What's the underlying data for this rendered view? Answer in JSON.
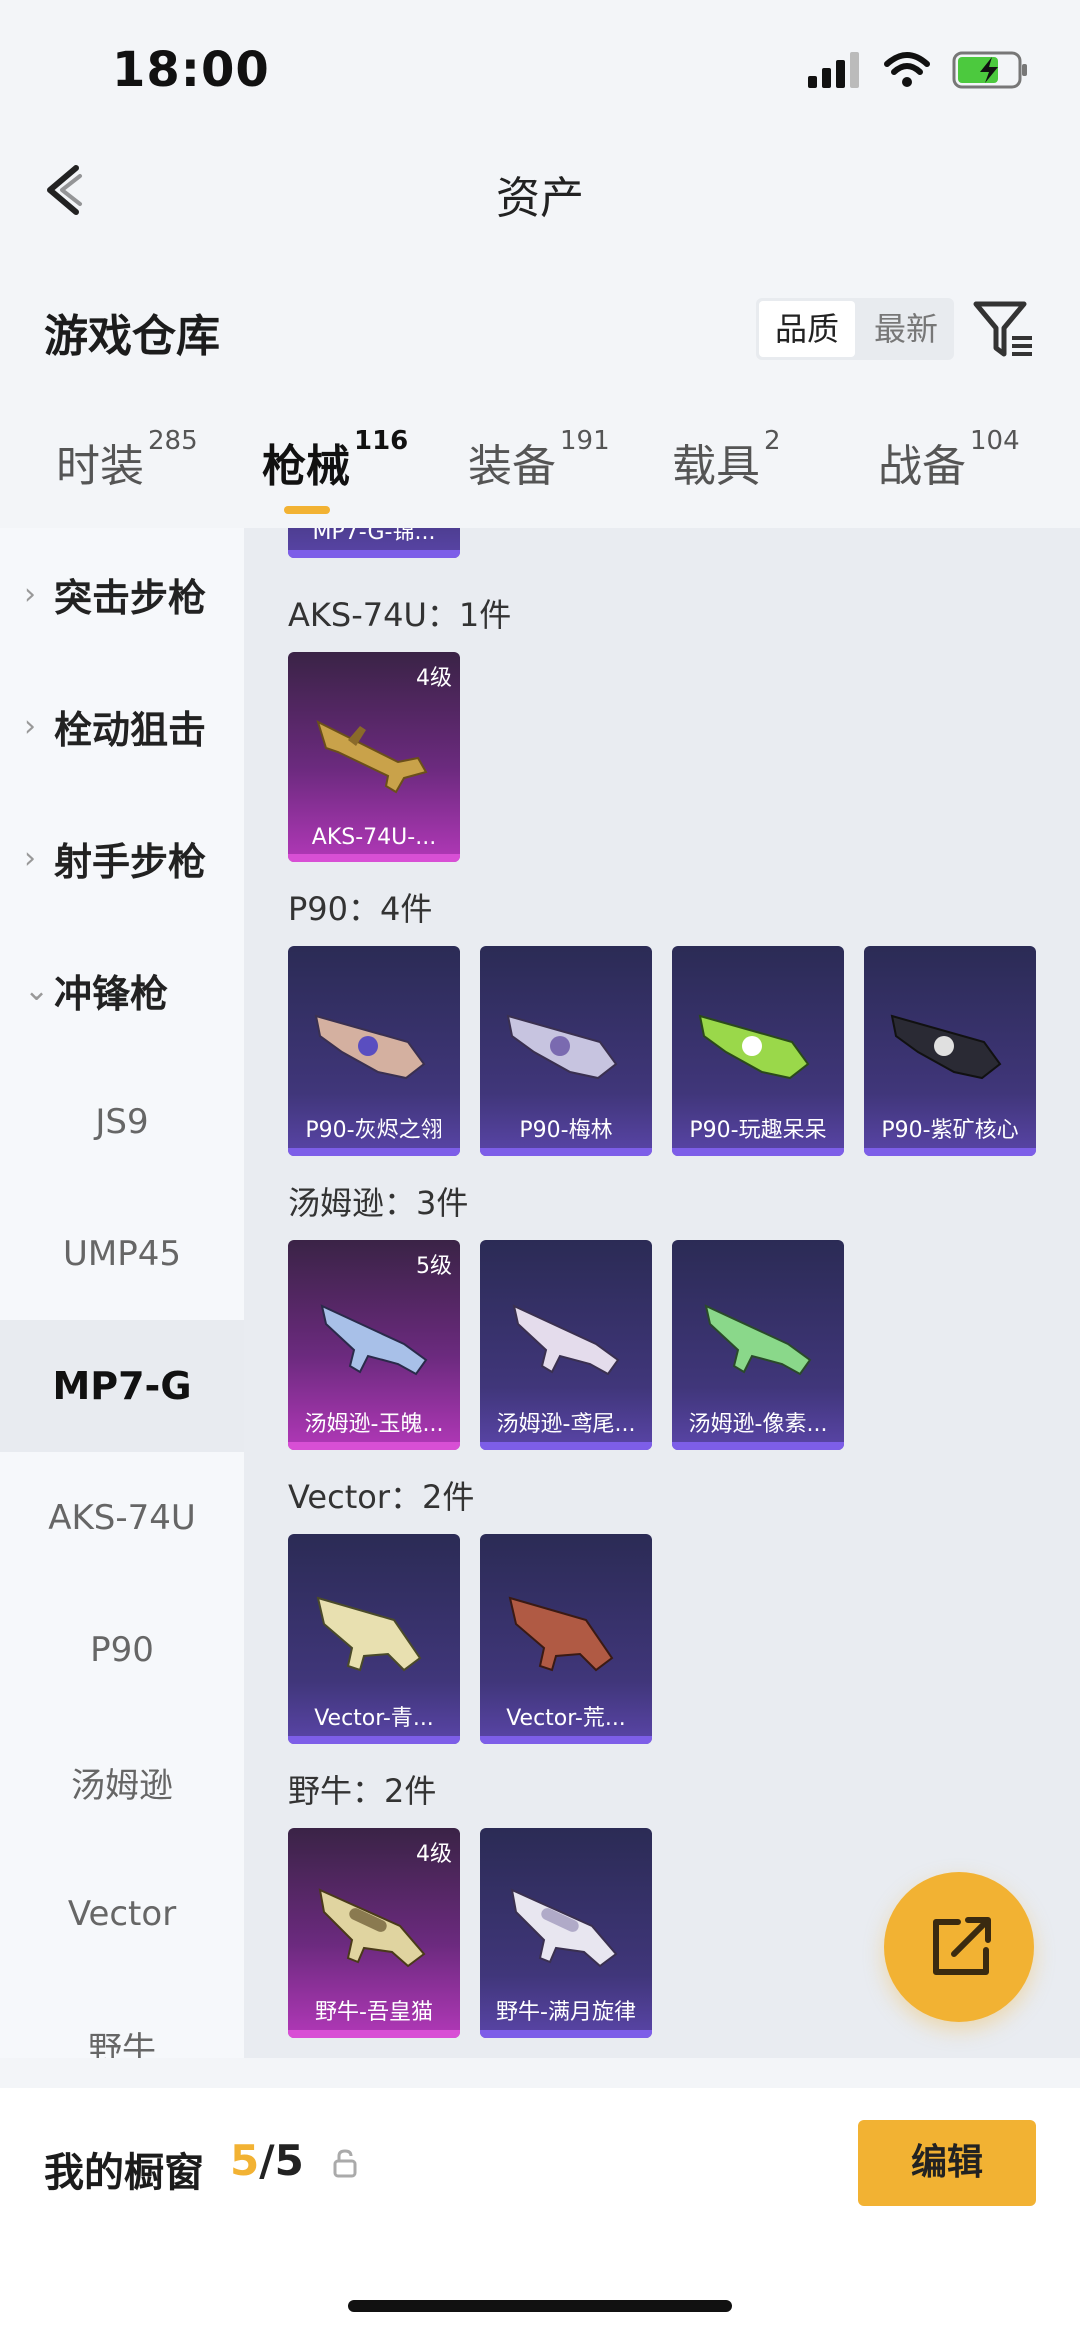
{
  "status": {
    "time": "18:00"
  },
  "nav": {
    "title": "资产"
  },
  "warehouse": {
    "title": "游戏仓库",
    "sort_options": [
      "品质",
      "最新"
    ]
  },
  "tabs": [
    {
      "label": "时装",
      "count": "285"
    },
    {
      "label": "枪械",
      "count": "116"
    },
    {
      "label": "装备",
      "count": "191"
    },
    {
      "label": "载具",
      "count": "2"
    },
    {
      "label": "战备",
      "count": "104"
    }
  ],
  "sidebar": {
    "categories": [
      "突击步枪",
      "栓动狙击",
      "射手步枪",
      "冲锋枪"
    ],
    "subitems": [
      "JS9",
      "UMP45",
      "MP7-G",
      "AKS-74U",
      "P90",
      "汤姆逊",
      "Vector",
      "野牛"
    ]
  },
  "content": {
    "partial_top_card": "MP7-G-锦...",
    "groups": [
      {
        "label": "AKS-74U：1件",
        "cards": [
          {
            "name": "AKS-74U-...",
            "level": "4级",
            "quality": "pink"
          }
        ]
      },
      {
        "label": "P90：4件",
        "cards": [
          {
            "name": "P90-灰烬之翎",
            "level": "",
            "quality": "purple"
          },
          {
            "name": "P90-梅林",
            "level": "",
            "quality": "purple"
          },
          {
            "name": "P90-玩趣呆呆",
            "level": "",
            "quality": "purple"
          },
          {
            "name": "P90-紫矿核心",
            "level": "",
            "quality": "purple"
          }
        ]
      },
      {
        "label": "汤姆逊：3件",
        "cards": [
          {
            "name": "汤姆逊-玉魄...",
            "level": "5级",
            "quality": "pink"
          },
          {
            "name": "汤姆逊-鸢尾...",
            "level": "",
            "quality": "purple"
          },
          {
            "name": "汤姆逊-像素...",
            "level": "",
            "quality": "purple"
          }
        ]
      },
      {
        "label": "Vector：2件",
        "cards": [
          {
            "name": "Vector-青...",
            "level": "",
            "quality": "purple"
          },
          {
            "name": "Vector-荒...",
            "level": "",
            "quality": "purple"
          }
        ]
      },
      {
        "label": "野牛：2件",
        "cards": [
          {
            "name": "野牛-吾皇猫",
            "level": "4级",
            "quality": "pink"
          },
          {
            "name": "野牛-满月旋律",
            "level": "",
            "quality": "purple"
          }
        ]
      }
    ]
  },
  "showcase": {
    "label": "我的橱窗",
    "current": "5",
    "total": "/5"
  },
  "edit_label": "编辑",
  "colors": {
    "accent": "#f2b233",
    "purple_card": "#40367a",
    "pink_card": "#b238b8"
  },
  "icons": [
    "back-arrow-icon",
    "filter-icon",
    "share-external-icon",
    "lock-icon",
    "signal-icon",
    "wifi-icon",
    "battery-icon"
  ]
}
